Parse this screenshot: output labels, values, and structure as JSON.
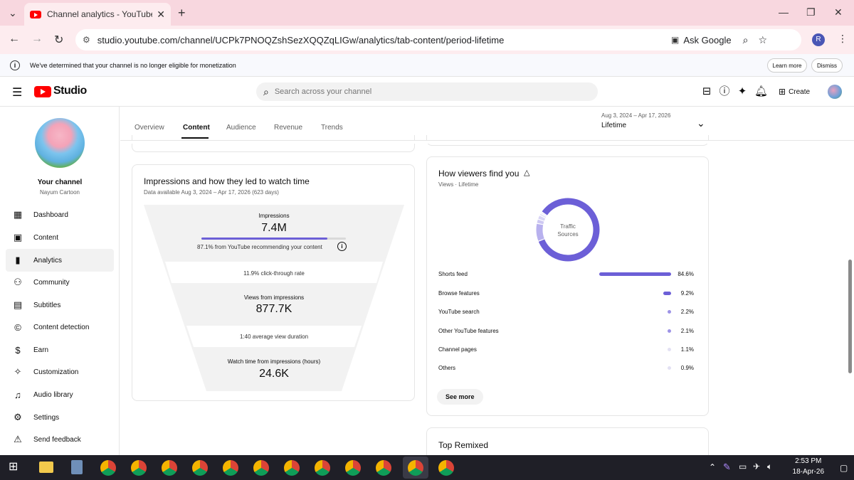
{
  "browser": {
    "tab_title": "Channel analytics - YouTube St",
    "url": "studio.youtube.com/channel/UCPk7PNOQZshSezXQQZqLIGw/analytics/tab-content/period-lifetime",
    "ask_google": "Ask Google",
    "profile_initial": "R"
  },
  "infobar": {
    "message": "We've determined that your channel is no longer eligible for monetization",
    "learn_more": "Learn more",
    "dismiss": "Dismiss"
  },
  "header": {
    "logo_text": "Studio",
    "search_placeholder": "Search across your channel",
    "create_label": "Create"
  },
  "sidebar": {
    "channel_title": "Your channel",
    "channel_name": "Nayum Cartoon",
    "items": [
      {
        "label": "Dashboard"
      },
      {
        "label": "Content"
      },
      {
        "label": "Analytics"
      },
      {
        "label": "Community"
      },
      {
        "label": "Subtitles"
      },
      {
        "label": "Content detection"
      },
      {
        "label": "Earn"
      },
      {
        "label": "Customization"
      },
      {
        "label": "Audio library"
      },
      {
        "label": "Settings"
      },
      {
        "label": "Send feedback"
      }
    ]
  },
  "tabs": [
    "Overview",
    "Content",
    "Audience",
    "Revenue",
    "Trends"
  ],
  "date_range": {
    "range": "Aug 3, 2024 – Apr 17, 2026",
    "label": "Lifetime"
  },
  "impressions_card": {
    "title": "Impressions and how they led to watch time",
    "subtitle": "Data available Aug 3, 2024 – Apr 17, 2026 (623 days)",
    "impressions_label": "Impressions",
    "impressions_value": "7.4M",
    "recommending_text": "87.1% from YouTube recommending your content",
    "recommending_fraction": 0.871,
    "ctr_text": "11.9% click-through rate",
    "views_label": "Views from impressions",
    "views_value": "877.7K",
    "avg_duration_text": "1:40 average view duration",
    "watch_label": "Watch time from impressions (hours)",
    "watch_value": "24.6K"
  },
  "viewers_card": {
    "title": "How viewers find you",
    "subtitle": "Views · Lifetime",
    "donut_line1": "Traffic",
    "donut_line2": "Sources",
    "sources": [
      {
        "label": "Shorts feed",
        "value": "84.6%",
        "pct": 84.6
      },
      {
        "label": "Browse features",
        "value": "9.2%",
        "pct": 9.2
      },
      {
        "label": "YouTube search",
        "value": "2.2%",
        "pct": 2.2
      },
      {
        "label": "Other YouTube features",
        "value": "2.1%",
        "pct": 2.1
      },
      {
        "label": "Channel pages",
        "value": "1.1%",
        "pct": 1.1
      },
      {
        "label": "Others",
        "value": "0.9%",
        "pct": 0.9
      }
    ],
    "see_more": "See more"
  },
  "top_remixed": {
    "title": "Top Remixed"
  },
  "taskbar": {
    "time": "2:53 PM",
    "date": "18-Apr-26"
  },
  "colors": {
    "accent": "#6c5fd7",
    "youtube_red": "#ff0000"
  }
}
